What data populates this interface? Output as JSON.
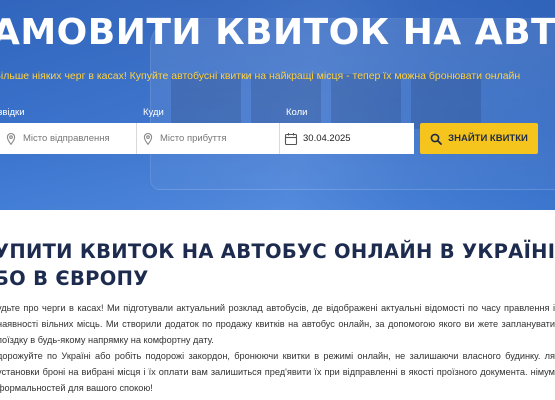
{
  "hero": {
    "title": "АМОВИТИ КВИТОК НА АВТОБУС",
    "subtitle": "Більше ніяких черг в касах! Купуйте автобусні квитки на найкращі місця - тепер їх можна бронювати онлайн"
  },
  "search": {
    "from_label": "звідки",
    "to_label": "Куди",
    "date_label": "Коли",
    "from_placeholder": "Місто відправлення",
    "to_placeholder": "Місто прибуття",
    "date_value": "30.04.2025",
    "button_label": "ЗНАЙТИ КВИТКИ",
    "icons": {
      "from": "location-pin-icon",
      "to": "location-pin-icon",
      "date": "calendar-icon",
      "button": "search-icon"
    }
  },
  "content": {
    "title_line1": "УПИТИ КВИТОК НА АВТОБУС ОНЛАЙН В УКРАЇНІ",
    "title_line2": "БО В ЄВРОПУ",
    "paragraph1": "удьте про черги в касах! Ми підготували актуальний розклад автобусів, де відображені актуальні відомості по часу правлення і наявності вільних місць. Ми створили додаток по продажу квитків на автобус онлайн, за допомогою якого ви жете запланувати поїздку в будь-якому напрямку на комфортну дату.",
    "paragraph2": "дорожуйте по Україні або робіть подорожі закордон, бронюючи квитки в режимі онлайн, не залишаючи власного будинку. ля установки броні на вибрані місця і їх оплати вам залишиться пред'явити їх при відправленні в якості проїзного документа. німум формальностей для вашого спокою!"
  },
  "colors": {
    "hero_blue": "#2f68c8",
    "accent_yellow": "#f6c51d",
    "subtitle_yellow": "#ffd23f",
    "title_navy": "#1d2b4f",
    "text": "#333333"
  }
}
